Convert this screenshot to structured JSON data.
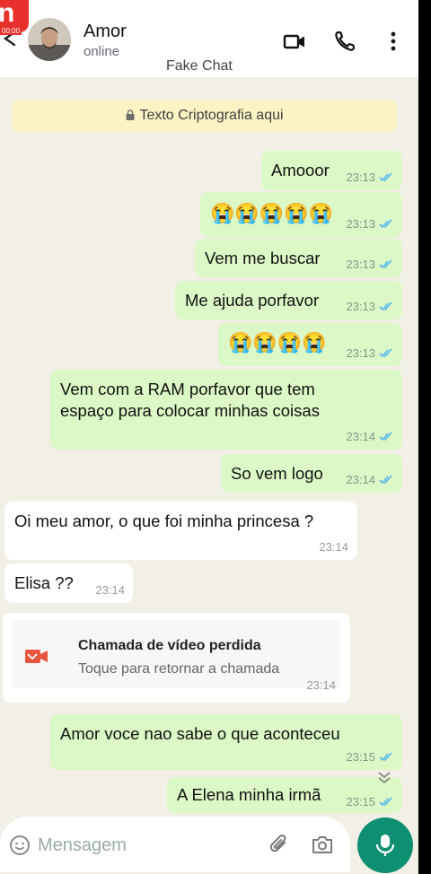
{
  "recording": {
    "badge_time": "00:00"
  },
  "header": {
    "contact_name": "Amor",
    "status": "online",
    "app_title": "Fake Chat"
  },
  "chat": {
    "encryption_notice": "Texto Criptografia aqui",
    "messages": [
      {
        "dir": "out",
        "text": "Amooor",
        "time": "23:13",
        "ticks": "read"
      },
      {
        "dir": "out",
        "text": "😭😭😭😭😭",
        "time": "23:13",
        "ticks": "read"
      },
      {
        "dir": "out",
        "text": "Vem me buscar",
        "time": "23:13",
        "ticks": "read"
      },
      {
        "dir": "out",
        "text": "Me ajuda porfavor",
        "time": "23:13",
        "ticks": "read"
      },
      {
        "dir": "out",
        "text": "😭😭😭😭",
        "time": "23:13",
        "ticks": "read"
      },
      {
        "dir": "out",
        "text": "Vem com a RAM porfavor que tem espaço para colocar minhas coisas",
        "time": "23:14",
        "ticks": "read"
      },
      {
        "dir": "out",
        "text": "So vem logo",
        "time": "23:14",
        "ticks": "read"
      },
      {
        "dir": "in",
        "text": "Oi meu amor, o que foi minha princesa ?",
        "time": "23:14"
      },
      {
        "dir": "in",
        "text": "Elisa ??",
        "time": "23:14"
      },
      {
        "dir": "out",
        "text": "Amor voce nao sabe o que aconteceu",
        "time": "23:15",
        "ticks": "read"
      },
      {
        "dir": "out",
        "text": "A Elena minha irmã",
        "time": "23:15",
        "ticks": "read"
      }
    ],
    "missed_call": {
      "title": "Chamada de vídeo perdida",
      "subtitle": "Toque para retornar a chamada",
      "time": "23:14"
    }
  },
  "composer": {
    "placeholder": "Mensagem"
  },
  "colors": {
    "outgoing_bubble": "#dcf8c6",
    "incoming_bubble": "#ffffff",
    "chat_background": "#f2efe6",
    "read_ticks": "#4fb6ec",
    "mic_button": "#0f8f72",
    "missed_call_icon": "#e8553e"
  }
}
